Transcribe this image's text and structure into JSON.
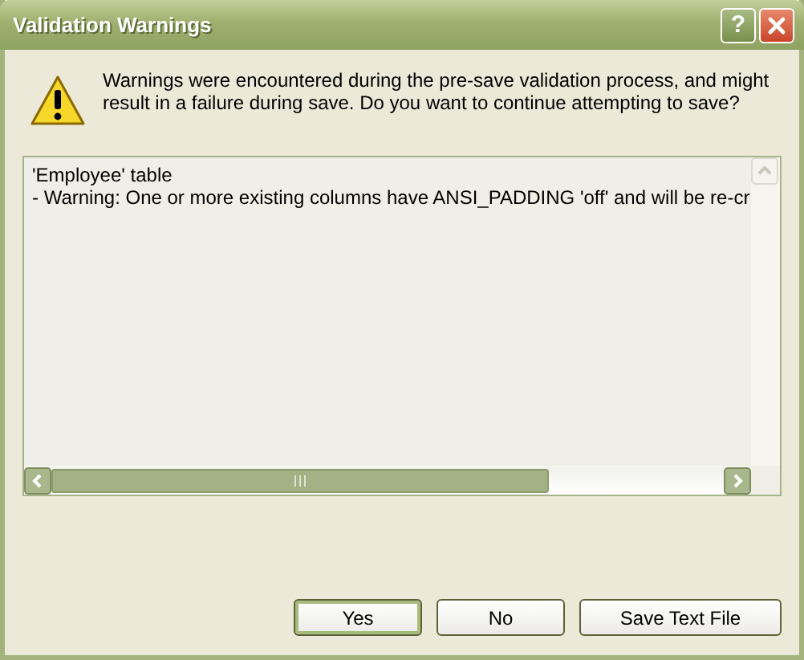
{
  "window": {
    "title": "Validation Warnings",
    "controls": [
      "?"
    ]
  },
  "message": "Warnings were encountered during the pre-save validation process, and might result in a failure during save. Do you want to continue attempting to save?",
  "log_lines": [
    "'Employee' table",
    "- Warning: One or more existing columns have ANSI_PADDING 'off' and will be re-cr"
  ],
  "buttons": [
    {
      "label": "Yes",
      "default": true
    },
    {
      "label": "No",
      "default": false
    },
    {
      "label": "Save Text File",
      "default": false
    }
  ]
}
